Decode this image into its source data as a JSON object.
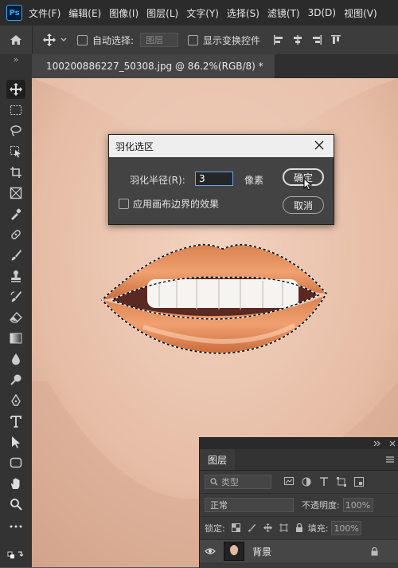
{
  "app": {
    "logo": "Ps"
  },
  "menu": [
    "文件(F)",
    "编辑(E)",
    "图像(I)",
    "图层(L)",
    "文字(Y)",
    "选择(S)",
    "滤镜(T)",
    "3D(D)",
    "视图(V)"
  ],
  "options": {
    "auto_select_label": "自动选择:",
    "auto_select_value": "图层",
    "show_transform_label": "显示变换控件"
  },
  "document": {
    "tab_title": "100200886227_50308.jpg @ 86.2%(RGB/8) *",
    "collapse_marker": "»"
  },
  "dialog": {
    "title": "羽化选区",
    "radius_label": "羽化半径(R):",
    "radius_value": "3",
    "unit": "像素",
    "apply_canvas_label": "应用画布边界的效果",
    "ok_label": "确定",
    "cancel_label": "取消"
  },
  "layers_panel": {
    "tab": "图层",
    "filter_label": "类型",
    "blend_mode": "正常",
    "opacity_label": "不透明度:",
    "opacity_value": "100%",
    "lock_label": "锁定:",
    "fill_label": "填充:",
    "fill_value": "100%",
    "layer_name": "背景"
  },
  "colors": {
    "accent": "#31a8ff",
    "dialog_bg": "#434343",
    "selection": "#ffffff"
  }
}
